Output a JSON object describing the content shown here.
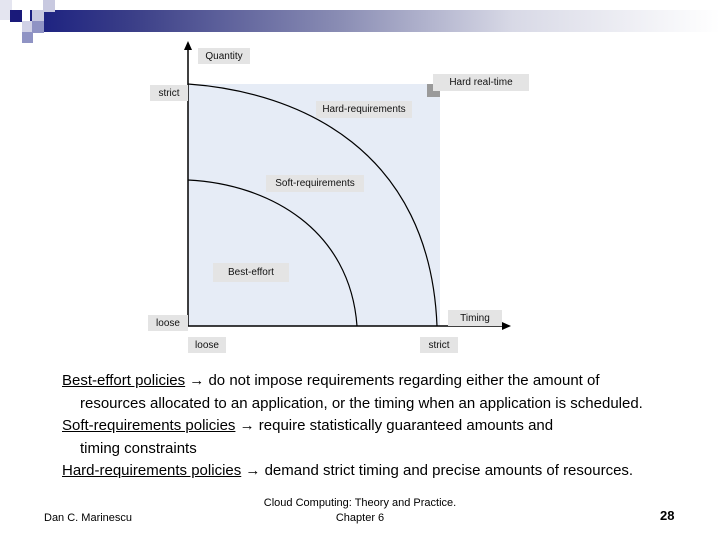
{
  "theme": {
    "header_gradient_start": "#1a1f80",
    "square_dark": "#1a1a7a",
    "square_light": "#c8c9e0",
    "square_mid": "#8f93c4",
    "panel_fill": "#e6ecf6",
    "label_fill": "#e4e4e4",
    "corner_marker": "#9a9a9a"
  },
  "diagram": {
    "y_axis_title": "Quantity",
    "x_axis_title": "Timing",
    "y_tick_strict": "strict",
    "y_tick_loose": "loose",
    "x_tick_loose": "loose",
    "x_tick_strict": "strict",
    "regions": {
      "hard_real_time": "Hard real-time",
      "hard_requirements": "Hard-requirements",
      "soft_requirements": "Soft-requirements",
      "best_effort": "Best-effort"
    }
  },
  "bullets": [
    {
      "term": "Best-effort policies",
      "arrow": "→",
      "text": " do not impose requirements regarding either the amount of",
      "continuation": "resources allocated to an application, or the timing when an application is scheduled."
    },
    {
      "term": "Soft-requirements policies",
      "arrow": "→",
      "text": "  require statistically guaranteed amounts and",
      "continuation": "timing constraints"
    },
    {
      "term": "Hard-requirements policies",
      "arrow": "→",
      "text": " demand strict timing and precise amounts of resources.",
      "continuation": ""
    }
  ],
  "footer": {
    "author": "Dan C. Marinescu",
    "title_line1": "Cloud Computing: Theory and Practice.",
    "title_line2": "Chapter 6",
    "page_number": "28"
  }
}
